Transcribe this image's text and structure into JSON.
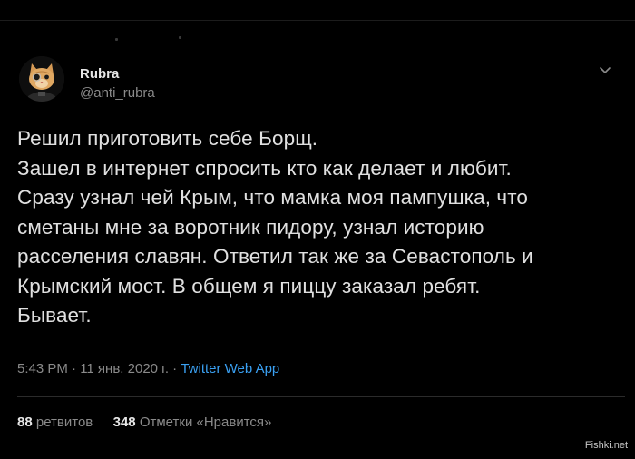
{
  "author": {
    "name": "Rubra",
    "handle": "@anti_rubra",
    "avatar_icon": "cat-avatar-icon"
  },
  "tweet": {
    "lines": [
      "Решил приготовить себе Борщ.",
      "Зашел в интернет спросить кто как делает и любит.",
      "Сразу узнал чей Крым, что мамка моя пампушка, что",
      "сметаны мне за воротник пидору, узнал историю",
      "расселения славян. Ответил так же за Севастополь и",
      "Крымский мост. В общем я пиццу заказал ребят.",
      "Бывает."
    ]
  },
  "meta": {
    "timestamp": "5:43 PM · 11 янв. 2020 г. · ",
    "app": "Twitter Web App"
  },
  "stats": {
    "retweets_count": "88",
    "retweets_label": "ретвитов",
    "likes_count": "348",
    "likes_label": "Отметки «Нравится»"
  },
  "watermark": "Fishki.net",
  "colors": {
    "background": "#000000",
    "text": "#e0e0e0",
    "muted": "#8a8a8a",
    "link": "#3aa0f2"
  }
}
